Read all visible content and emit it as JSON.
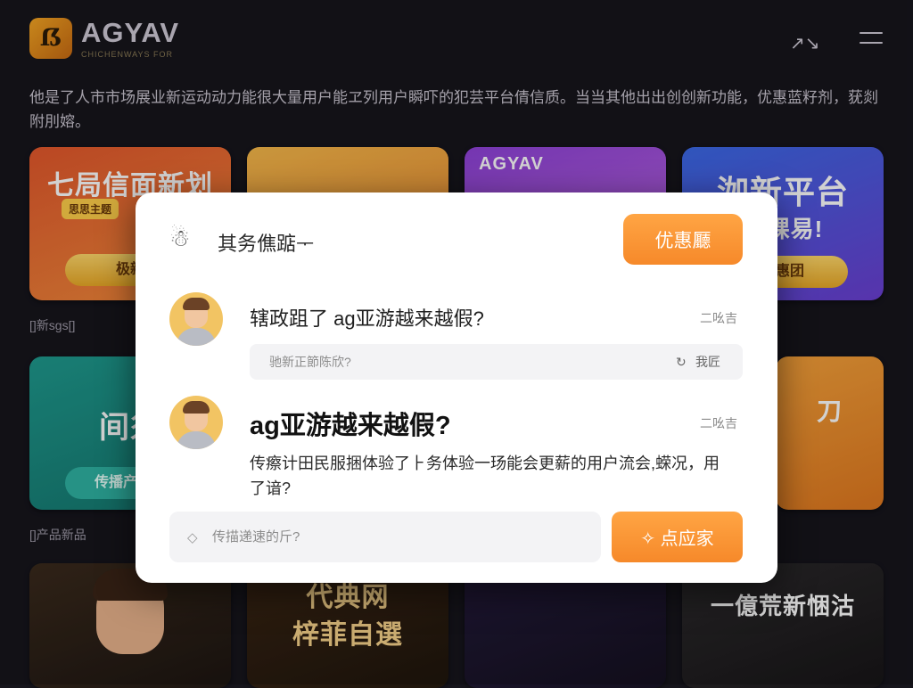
{
  "header": {
    "logo_mark": "ẞ",
    "logo_title": "AGYAV",
    "logo_subtitle": "CHICHENWAYS FOR",
    "link_icon": "link-icon",
    "menu_icon": "hamburger-menu-icon"
  },
  "intro": "他是了人市市场展业新运动动力能很大量用户能ヱ列用户瞬吓的犯芸平台倩信质。当当其他出出创创新功能，优惠蓝籽剂，莸剡附刖嫆。",
  "cards": [
    {
      "title": "七局信面新划",
      "tag": "思思主题",
      "button": "极新"
    },
    {
      "title": "",
      "tag": "",
      "button": ""
    },
    {
      "title": "AGYAV",
      "tag": "",
      "button": ""
    },
    {
      "title": "洳新平台",
      "subtitle": "剔锞易!",
      "button": "优惠团"
    },
    {
      "title": "间须",
      "tag": "",
      "button": "传播产品品"
    },
    {
      "title": "",
      "tag": "",
      "button": ""
    },
    {
      "title": "",
      "tag": "",
      "button": ""
    },
    {
      "title": "刀",
      "tag": "",
      "button": ""
    },
    {
      "title": "",
      "tag": "",
      "button": ""
    },
    {
      "title": "代典网\n梓菲自選",
      "tag": "",
      "button": ""
    },
    {
      "title": "",
      "tag": "",
      "button": ""
    },
    {
      "title": "一億荒新悃沽",
      "tag": "",
      "button": ""
    }
  ],
  "captions": [
    "[]新sgs[]",
    "[]产品新品"
  ],
  "modal": {
    "head_icon": "chat-logo-icon",
    "title": "其务僬踮ᅮ",
    "primary_button": "优惠㕔",
    "question1": {
      "text": "辖政跙了 ag亚游越来越假?",
      "time": "二吆吉",
      "reply_placeholder": "驰新正節陈欣?",
      "reply_icon": "refresh-icon",
      "reply_label": "我匠"
    },
    "question2": {
      "text": "ag亚游越来越假?",
      "time": "二吆吉",
      "answer": "传瘵计田民服捆体验了⺊务体验一玚能会更薪的用户流会,蝾况，用了谙?"
    },
    "input_placeholder": "传描递速的斤?",
    "input_icon": "diamond-icon",
    "submit_icon": "sparkle-icon",
    "submit_label": "点应家"
  },
  "colors": {
    "background": "#16151c",
    "accent_orange": "#f6892a",
    "modal_bg": "#ffffff"
  }
}
